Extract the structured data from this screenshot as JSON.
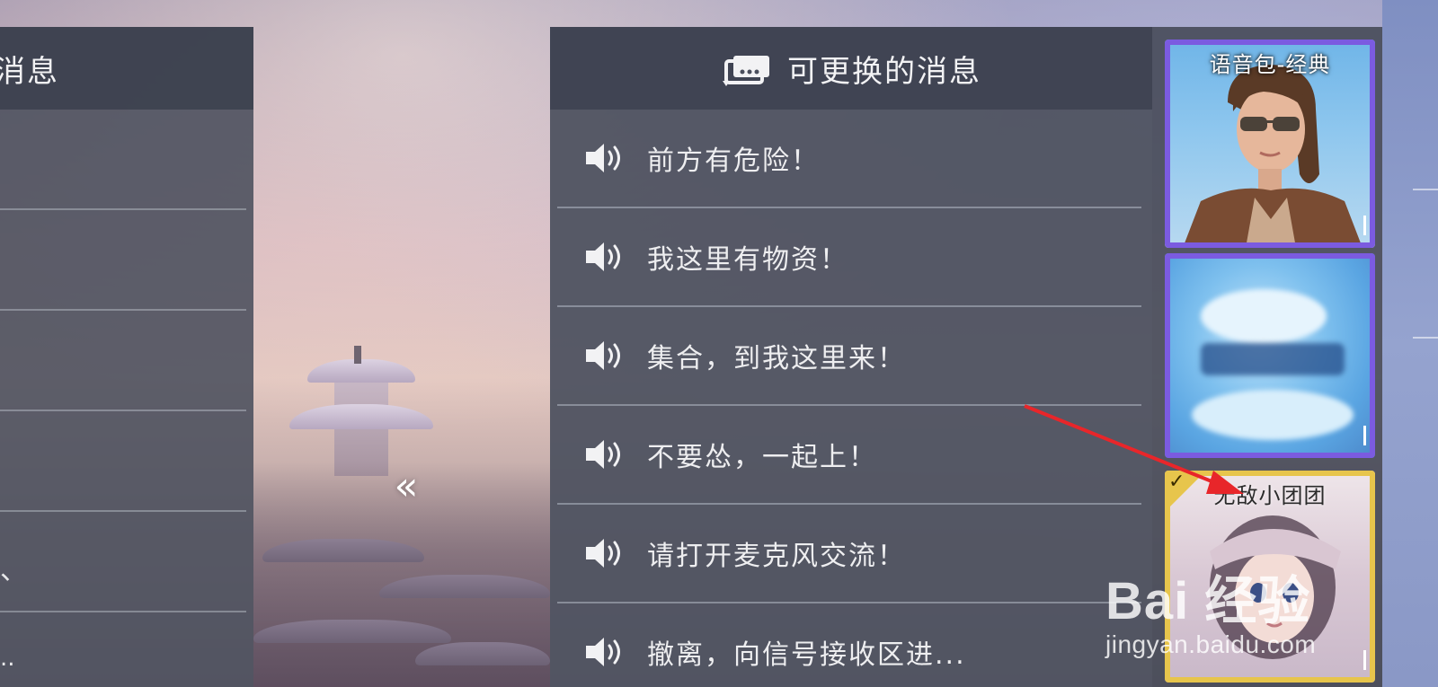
{
  "left_panel": {
    "title": "消息",
    "row_stub": "、",
    "last_row_text": ".."
  },
  "collapse_button": {
    "glyph": "«"
  },
  "message_panel": {
    "header_icon": "message-exchange-icon",
    "title": "可更换的消息",
    "messages": [
      {
        "icon": "speaker-icon",
        "text": "前方有危险！"
      },
      {
        "icon": "speaker-icon",
        "text": "我这里有物资！"
      },
      {
        "icon": "speaker-icon",
        "text": "集合，到我这里来！"
      },
      {
        "icon": "speaker-icon",
        "text": "不要怂，一起上！"
      },
      {
        "icon": "speaker-icon",
        "text": "请打开麦克风交流！"
      },
      {
        "icon": "speaker-icon",
        "text": "撤离，向信号接收区进..."
      }
    ]
  },
  "voice_packs": [
    {
      "name": "语音包-经典",
      "frame_color": "#7b5be0",
      "selected": false
    },
    {
      "name": "",
      "frame_color": "#7b5be0",
      "selected": false
    },
    {
      "name": "无敌小团团",
      "frame_color": "#e7c54c",
      "selected": true,
      "check": "✓"
    }
  ],
  "watermark": {
    "main": "Bai 经验",
    "url": "jingyan.baidu.com"
  },
  "colors": {
    "annotation_arrow": "#e8262a",
    "selected_frame": "#e7c54c",
    "rare_frame": "#7b5be0"
  }
}
